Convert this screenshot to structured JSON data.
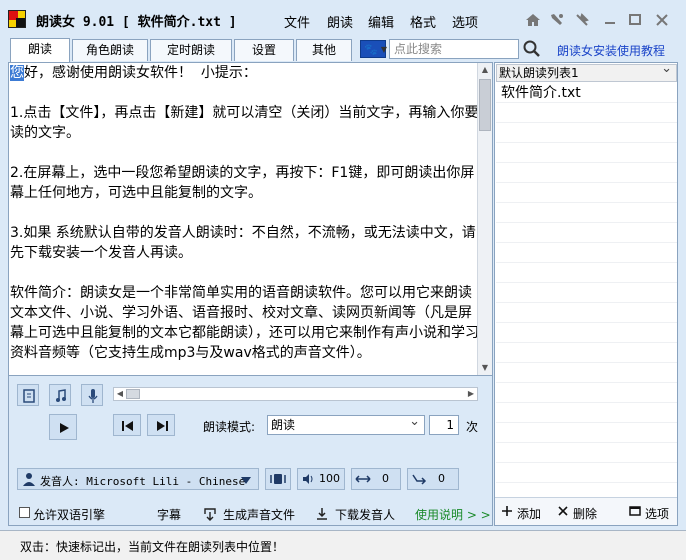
{
  "app": {
    "title": "朗读女 9.01 [ 软件简介.txt ]",
    "menu": [
      "文件",
      "朗读",
      "编辑",
      "格式",
      "选项"
    ]
  },
  "tabs": [
    "朗读",
    "角色朗读",
    "定时朗读",
    "设置",
    "其他"
  ],
  "search": {
    "placeholder": "点此搜索"
  },
  "help_link": "朗读女安装使用教程",
  "editor": {
    "lines": [
      {
        "sel": "您",
        "rest": "好，感谢使用朗读女软件！  小提示："
      },
      {
        "sel": "",
        "rest": ""
      },
      {
        "sel": "",
        "rest": "1.点击【文件】，再点击【新建】就可以清空（关闭）当前文字，再输入你要读的文字。"
      },
      {
        "sel": "",
        "rest": ""
      },
      {
        "sel": "",
        "rest": "2.在屏幕上，选中一段您希望朗读的文字，再按下：F1键，即可朗读出你屏幕上任何地方，可选中且能复制的文字。"
      },
      {
        "sel": "",
        "rest": ""
      },
      {
        "sel": "",
        "rest": "3.如果 系统默认自带的发音人朗读时：不自然，不流畅，或无法读中文，请先下载安装一个发音人再读。"
      },
      {
        "sel": "",
        "rest": ""
      },
      {
        "sel": "",
        "rest": "软件简介：朗读女是一个非常简单实用的语音朗读软件。您可以用它来朗读文本文件、小说、学习外语、语音报时、校对文章、读网页新闻等（凡是屏幕上可选中且能复制的文本它都能朗读），还可以用它来制作有声小说和学习资料音频等（它支持生成mp3与及wav格式的声音文件）。"
      }
    ]
  },
  "controls": {
    "mode_label": "朗读模式:",
    "mode_value": "朗读",
    "times_value": "1",
    "times_label": "次",
    "voice": "发音人: Microsoft Lili - Chinese",
    "volume": "100",
    "rate": "0",
    "pitch": "0",
    "dual_engine": "允许双语引擎",
    "subtitle": "字幕",
    "gen_audio": "生成声音文件",
    "download_voice": "下载发音人",
    "usage": "使用说明 > >"
  },
  "playlist": {
    "selected_list": "默认朗读列表1",
    "items": [
      "软件简介.txt"
    ],
    "add": "添加",
    "delete": "删除",
    "options": "选项"
  },
  "status": "双击：快速标记出，当前文件在朗读列表中位置！",
  "colors": {
    "accent": "#1a44c8",
    "selection": "#3c7bd4",
    "usage": "#1a8a2a",
    "panel": "#dbe9f7"
  }
}
